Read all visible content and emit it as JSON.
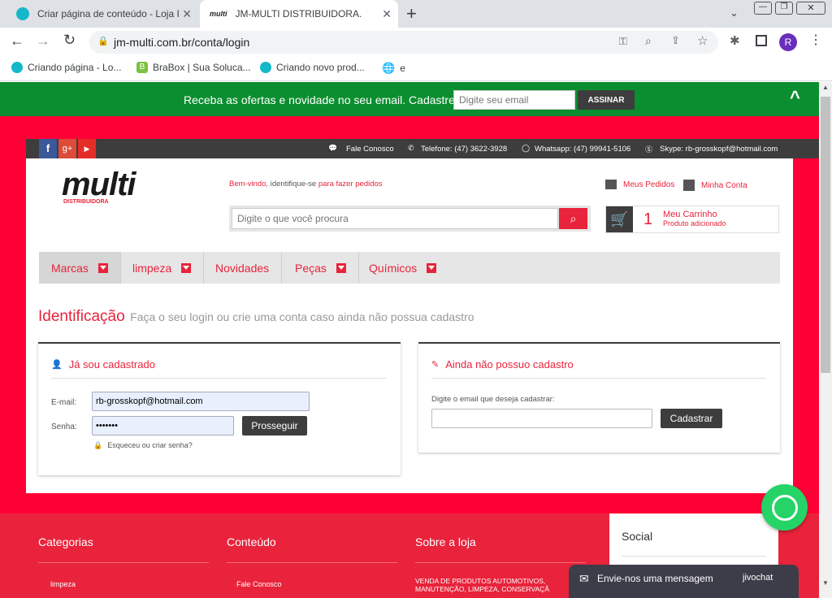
{
  "browser": {
    "tabs": [
      {
        "title": "Criar página de conteúdo - Loja I",
        "active": false
      },
      {
        "title": "JM-MULTI DISTRIBUIDORA.",
        "active": true
      }
    ],
    "new_tab": "+",
    "url": "jm-multi.com.br/conta/login",
    "profile_initial": "R",
    "bookmarks": [
      "Criando página - Lo...",
      "BraBox | Sua Soluca...",
      "Criando novo prod...",
      "e"
    ]
  },
  "newsletter": {
    "text": "Receba as ofertas e novidade no seu email. Cadastre-se",
    "placeholder": "Digite seu email",
    "button": "ASSINAR",
    "collapse_icon": "^"
  },
  "social": [
    "f",
    "g+",
    "▶"
  ],
  "contact": {
    "fale": "Fale Conosco",
    "telefone": "Telefone: (47) 3622-3928",
    "whatsapp": "Whatsapp: (47) 99941-5106",
    "skype": "Skype: rb-grosskopf@hotmail.com"
  },
  "header": {
    "logo_text": "multi",
    "logo_sub": "DISTRIBUIDORA",
    "welcome_1": "Bem-vindo,",
    "welcome_2": " identifique-se",
    "welcome_3": " para fazer pedidos",
    "search_placeholder": "Digite o que você procura",
    "meus_pedidos": "Meus Pedidos",
    "minha_conta": "Minha Conta",
    "cart_count": "1",
    "cart_title": "Meu Carrinho",
    "cart_sub": "Produto adicionado"
  },
  "nav": [
    "Marcas",
    "limpeza",
    "Novidades",
    "Peças",
    "Químicos"
  ],
  "identificacao": {
    "title": "Identificação",
    "subtitle": "Faça o seu login ou crie uma conta caso ainda não possua cadastro"
  },
  "login": {
    "heading": "Já sou cadastrado",
    "email_label": "E-mail:",
    "email_value": "rb-grosskopf@hotmail.com",
    "senha_label": "Senha:",
    "senha_value": "•••••••",
    "button": "Prosseguir",
    "forgot": "Esqueceu ou criar senha?"
  },
  "register": {
    "heading": "Ainda não possuo cadastro",
    "label": "Digite o email que deseja cadastrar:",
    "button": "Cadastrar"
  },
  "footer": {
    "categorias": "Categorias",
    "categorias_item": "limpeza",
    "conteudo": "Conteúdo",
    "conteudo_item": "Fale Conosco",
    "sobre": "Sobre a loja",
    "sobre_text": "VENDA DE PRODUTOS AUTOMOTIVOS, MANUTENÇÃO, LIMPEZA, CONSERVAÇÃ",
    "social": "Social"
  },
  "chat": {
    "label": "Envie-nos uma mensagem",
    "brand": "jivochat"
  },
  "colors": {
    "brand": "#e8233b",
    "green": "#0b8e2f",
    "dark": "#3d3d3d",
    "whatsapp": "#25d366"
  }
}
